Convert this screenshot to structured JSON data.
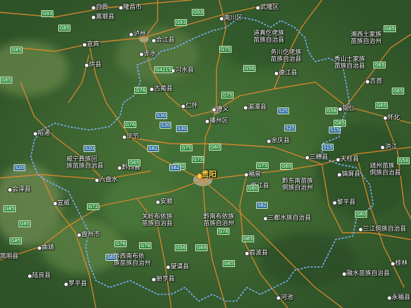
{
  "map": {
    "colors": {
      "boundary": "#7fb2ff",
      "road": "#e08a2e",
      "terrain_dark": "#345a2c",
      "terrain_light": "#5f8440",
      "urban": "#b7b09a"
    },
    "capital_label": "贵阳",
    "labels": [
      {
        "id": "zigong",
        "text": "自贡"
      },
      {
        "id": "longchang",
        "text": "隆昌市"
      },
      {
        "id": "wulong",
        "text": "武隆区"
      },
      {
        "id": "nanchuan",
        "text": "南川区"
      },
      {
        "id": "fushun",
        "text": "富顺县"
      },
      {
        "id": "luzhou",
        "text": "泸州"
      },
      {
        "id": "hejiang",
        "text": "合江县"
      },
      {
        "id": "daozhen",
        "text": "道真仡佬族\n苗族自治县"
      },
      {
        "id": "xiangxi",
        "text": "湘西土家族\n苗族自治州"
      },
      {
        "id": "yibin",
        "text": "宜宾"
      },
      {
        "id": "chishui",
        "text": "赤水"
      },
      {
        "id": "wuchuan",
        "text": "务川仡佬族\n苗族自治县"
      },
      {
        "id": "xiushan",
        "text": "秀山土家族\n苗族自治县"
      },
      {
        "id": "gong",
        "text": "珙县"
      },
      {
        "id": "xishui",
        "text": "习水县"
      },
      {
        "id": "dejiang",
        "text": "德江县"
      },
      {
        "id": "jishou",
        "text": "吉首"
      },
      {
        "id": "gulin",
        "text": "古蔺县"
      },
      {
        "id": "renhuai",
        "text": "仁怀"
      },
      {
        "id": "zunyi",
        "text": "遵义"
      },
      {
        "id": "meitan",
        "text": "湄潭县"
      },
      {
        "id": "tongren",
        "text": "铜仁"
      },
      {
        "id": "huaihua",
        "text": "怀化"
      },
      {
        "id": "bozhou",
        "text": "播州区"
      },
      {
        "id": "zhaotong",
        "text": "昭通"
      },
      {
        "id": "bijie",
        "text": "毕节"
      },
      {
        "id": "yuqing",
        "text": "余庆县"
      },
      {
        "id": "hongjiang",
        "text": "洪江"
      },
      {
        "id": "weining",
        "text": "威宁彝族回\n族苗族自治县"
      },
      {
        "id": "sansui",
        "text": "三穗县"
      },
      {
        "id": "tianzhu",
        "text": "天柱县"
      },
      {
        "id": "qianxi",
        "text": "黔西县"
      },
      {
        "id": "jingzhou",
        "text": "靖州苗族\n侗族自治县"
      },
      {
        "id": "jinping",
        "text": "锦屏县"
      },
      {
        "id": "liupanshui",
        "text": "六盘水"
      },
      {
        "id": "fuquan",
        "text": "福泉"
      },
      {
        "id": "qiandongnan",
        "text": "黔东南苗族\n侗族自治州"
      },
      {
        "id": "huize",
        "text": "会泽县"
      },
      {
        "id": "majiang",
        "text": "麻江县"
      },
      {
        "id": "xuanwei",
        "text": "宣威"
      },
      {
        "id": "anshun",
        "text": "安顺"
      },
      {
        "id": "liping",
        "text": "黎平县"
      },
      {
        "id": "guanling",
        "text": "关岭布依族\n苗族自治县"
      },
      {
        "id": "qiannan",
        "text": "黔南布依族\n苗族自治州"
      },
      {
        "id": "sandu",
        "text": "三都水族自治县"
      },
      {
        "id": "panzhou",
        "text": "盘州市"
      },
      {
        "id": "sanjiang",
        "text": "三江侗族自治县"
      },
      {
        "id": "qujing",
        "text": "曲靖"
      },
      {
        "id": "songming",
        "text": "嵩明县"
      },
      {
        "id": "qianxinan",
        "text": "黔西南布依\n族苗族自治州"
      },
      {
        "id": "libo",
        "text": "荔波县"
      },
      {
        "id": "wangmo",
        "text": "望谟县"
      },
      {
        "id": "guilin",
        "text": "桂林"
      },
      {
        "id": "luliang",
        "text": "陆良县"
      },
      {
        "id": "rongshui",
        "text": "融水苗族自治县"
      },
      {
        "id": "luoping",
        "text": "罗平县"
      },
      {
        "id": "ceheng",
        "text": "册亨县"
      },
      {
        "id": "hechi",
        "text": "河池"
      },
      {
        "id": "yongfu",
        "text": "永福县"
      }
    ],
    "shields": [
      {
        "id": "s1",
        "text": "G93"
      },
      {
        "id": "s2",
        "text": "G93"
      },
      {
        "id": "s3",
        "text": "G85"
      },
      {
        "id": "s4",
        "text": "G85"
      },
      {
        "id": "s5",
        "text": "G85"
      },
      {
        "id": "s6",
        "text": "G93"
      },
      {
        "id": "s7",
        "text": "G65"
      },
      {
        "id": "s8",
        "text": "G65"
      },
      {
        "id": "s9",
        "text": "G65"
      },
      {
        "id": "s10",
        "text": "G65"
      },
      {
        "id": "s11",
        "text": "G65"
      },
      {
        "id": "s12",
        "text": "G4215"
      },
      {
        "id": "s13",
        "text": "G76"
      },
      {
        "id": "s14",
        "text": "G75"
      },
      {
        "id": "s15",
        "text": "G75"
      },
      {
        "id": "s16",
        "text": "G56"
      },
      {
        "id": "s17",
        "text": "G56"
      },
      {
        "id": "s18",
        "text": "S30"
      },
      {
        "id": "s19",
        "text": "S30"
      },
      {
        "id": "s20",
        "text": "S25"
      },
      {
        "id": "s21",
        "text": "S25"
      },
      {
        "id": "s22",
        "text": "G76"
      },
      {
        "id": "s23",
        "text": "S20"
      },
      {
        "id": "s24",
        "text": "S82"
      },
      {
        "id": "s25",
        "text": "G60"
      },
      {
        "id": "s26",
        "text": "G75"
      },
      {
        "id": "s27",
        "text": "G60"
      },
      {
        "id": "s28",
        "text": "G65"
      },
      {
        "id": "s29",
        "text": "S62"
      },
      {
        "id": "s30",
        "text": "S62"
      },
      {
        "id": "s31",
        "text": "G75"
      },
      {
        "id": "s32",
        "text": "G60"
      },
      {
        "id": "s33",
        "text": "S15"
      },
      {
        "id": "s34",
        "text": "S15"
      },
      {
        "id": "s35",
        "text": "G78"
      },
      {
        "id": "s36",
        "text": "G69"
      },
      {
        "id": "s37",
        "text": "G78"
      },
      {
        "id": "s38",
        "text": "G56"
      },
      {
        "id": "s39",
        "text": "S65"
      },
      {
        "id": "s40",
        "text": "G76"
      },
      {
        "id": "s41",
        "text": "G72"
      },
      {
        "id": "s42",
        "text": "G75"
      },
      {
        "id": "s43",
        "text": "G65"
      },
      {
        "id": "s44",
        "text": "G65"
      },
      {
        "id": "s45",
        "text": "G60"
      },
      {
        "id": "s46",
        "text": "G56"
      },
      {
        "id": "s47",
        "text": "G85"
      },
      {
        "id": "s48",
        "text": "S30"
      },
      {
        "id": "s49",
        "text": "S20"
      },
      {
        "id": "s50",
        "text": "G85"
      },
      {
        "id": "s51",
        "text": "G85"
      },
      {
        "id": "s52",
        "text": "G60"
      }
    ]
  }
}
